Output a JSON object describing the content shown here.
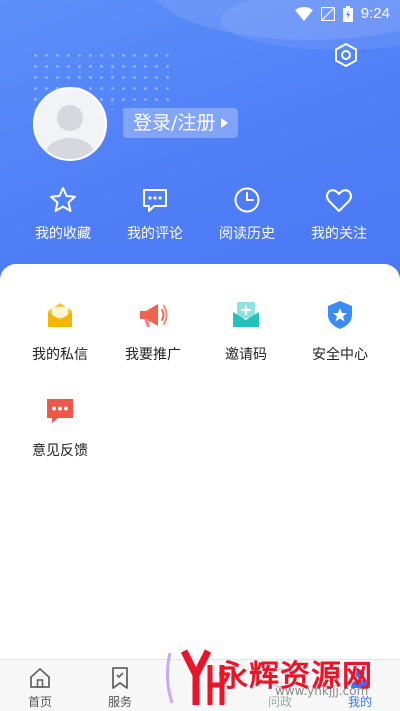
{
  "status_bar": {
    "time": "9:24"
  },
  "header": {
    "login_label": "登录/注册",
    "settings_icon": "hexagon-gear-icon",
    "quick_links": [
      {
        "label": "我的收藏",
        "icon": "star-icon"
      },
      {
        "label": "我的评论",
        "icon": "comment-icon"
      },
      {
        "label": "阅读历史",
        "icon": "clock-icon"
      },
      {
        "label": "我的关注",
        "icon": "heart-icon"
      }
    ]
  },
  "services": [
    {
      "label": "我的私信",
      "icon": "mail-icon",
      "color": "#f5b400"
    },
    {
      "label": "我要推广",
      "icon": "megaphone-icon",
      "color": "#f2624f"
    },
    {
      "label": "邀请码",
      "icon": "invite-icon",
      "color": "#22c1bb"
    },
    {
      "label": "安全中心",
      "icon": "shield-icon",
      "color": "#3b8bf5"
    },
    {
      "label": "意见反馈",
      "icon": "feedback-icon",
      "color": "#f0574a"
    }
  ],
  "tabbar": {
    "items": [
      {
        "label": "首页",
        "icon": "home-icon"
      },
      {
        "label": "服务",
        "icon": "bookmark-icon"
      },
      {
        "label": "问政",
        "icon": "ask-icon"
      },
      {
        "label": "我的",
        "icon": "user-icon"
      }
    ]
  },
  "watermark": {
    "brand": "永辉资源网",
    "url": "www.yhkjjj.com"
  },
  "colors": {
    "accent": "#4f7ef7",
    "active_tab": "#3b74f5"
  }
}
